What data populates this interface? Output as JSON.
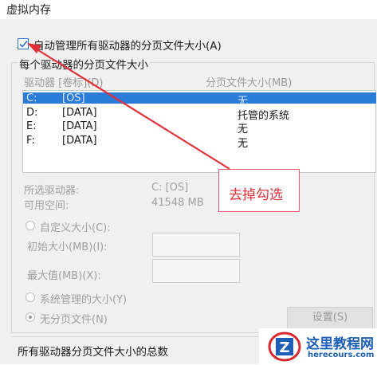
{
  "window": {
    "title": "虚拟内存"
  },
  "auto_manage": {
    "label": "自动管理所有驱动器的分页文件大小(A)",
    "checked": true
  },
  "group": {
    "title": "每个驱动器的分页文件大小"
  },
  "table": {
    "headers": [
      "驱动器 [卷标](D)",
      "分页文件大小(MB)"
    ],
    "rows": [
      {
        "drive": "C:",
        "label": "[OS]",
        "size": "无"
      },
      {
        "drive": "D:",
        "label": "[DATA]",
        "size": "托管的系统"
      },
      {
        "drive": "E:",
        "label": "[DATA]",
        "size": "无"
      },
      {
        "drive": "F:",
        "label": "[DATA]",
        "size": "无"
      }
    ]
  },
  "selected": {
    "drive_label": "所选驱动器:",
    "drive_value": "C:  [OS]",
    "space_label": "可用空间:",
    "space_value": "41548 MB"
  },
  "options": {
    "custom": "自定义大小(C):",
    "initial": "初始大小(MB)(I):",
    "max": "最大值(MB)(X):",
    "system": "系统管理的大小(Y)",
    "none": "无分页文件(N)"
  },
  "set_button": "设置(S)",
  "total_label": "所有驱动器分页文件大小的总数",
  "annotation": {
    "text": "去掉勾选",
    "color": "#e0303a"
  },
  "watermark": {
    "name": "这里教程网",
    "url": "herecours.com",
    "letter": "Z"
  },
  "colors": {
    "selection": "#2b7bd8",
    "checkbox": "#2b6fc6"
  }
}
